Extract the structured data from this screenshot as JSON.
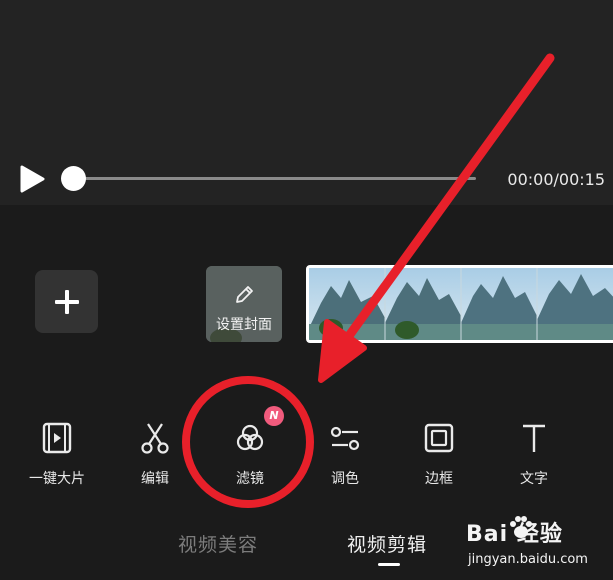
{
  "player": {
    "timecode": "00:00/00:15",
    "progress": 0
  },
  "timeline": {
    "cover_label": "设置封面"
  },
  "toolbar": {
    "items": [
      {
        "label": "一键大片",
        "icon": "film-icon"
      },
      {
        "label": "编辑",
        "icon": "scissors-icon"
      },
      {
        "label": "滤镜",
        "icon": "filter-icon",
        "badge": "N"
      },
      {
        "label": "调色",
        "icon": "sliders-icon"
      },
      {
        "label": "边框",
        "icon": "frame-icon"
      },
      {
        "label": "文字",
        "icon": "text-icon"
      }
    ]
  },
  "tabs": {
    "items": [
      {
        "label": "视频美容",
        "active": false
      },
      {
        "label": "视频剪辑",
        "active": true
      }
    ]
  },
  "watermark": {
    "brand": "Bai 经验",
    "url": "jingyan.baidu.com"
  },
  "colors": {
    "background": "#1b1b1b",
    "preview": "#232323",
    "badge": "#f15b7d",
    "annotation": "#e8202a"
  }
}
